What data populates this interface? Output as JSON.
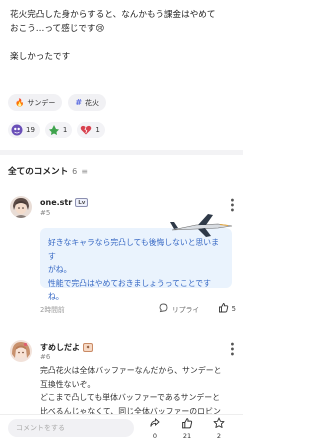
{
  "post": {
    "line1": "花火完凸した身からすると、なんかもう課金はやめて",
    "line2": "おこう…って感じです😢",
    "line3": "楽しかったです"
  },
  "tags": [
    {
      "icon": "fire-icon",
      "label": "サンデー"
    },
    {
      "icon": "hash-icon",
      "label": "花火"
    }
  ],
  "reactions": [
    {
      "icon": "purple-sticker-icon",
      "count": "19"
    },
    {
      "icon": "green-sticker-icon",
      "count": "1"
    },
    {
      "icon": "broken-heart-icon",
      "count": "1"
    }
  ],
  "comments_header": {
    "title": "全てのコメント",
    "count": "6",
    "sort_symbol": "≡"
  },
  "comments": [
    {
      "username": "one.str",
      "badge": "Lv",
      "number": "#5",
      "line1": "好きなキャラなら完凸しても後悔しないと思います",
      "line2": "がね。",
      "line3": "性能で完凸はやめておきましょうってことです",
      "line4": "ね。",
      "time": "2時間前",
      "reply_label": "リプライ",
      "likes": "5"
    },
    {
      "username": "すめしだよ",
      "badge": "✦",
      "number": "#6",
      "line1": "完凸花火は全体バッファーなんだから、サンデーと",
      "line2": "互換性ないぞ。",
      "line3": "どこまで凸しても単体バッファーであるサンデーと",
      "line4": "比べるんじゃなくて、同じ全体バッファーのロビン"
    }
  ],
  "bottom_bar": {
    "comment_placeholder": "コメントをする",
    "share_count": "0",
    "like_count": "21",
    "star_count": "2"
  },
  "colors": {
    "accent_blue": "#3567c4",
    "quote_bg": "#eaf3fd",
    "divider": "#f3f3f5"
  }
}
